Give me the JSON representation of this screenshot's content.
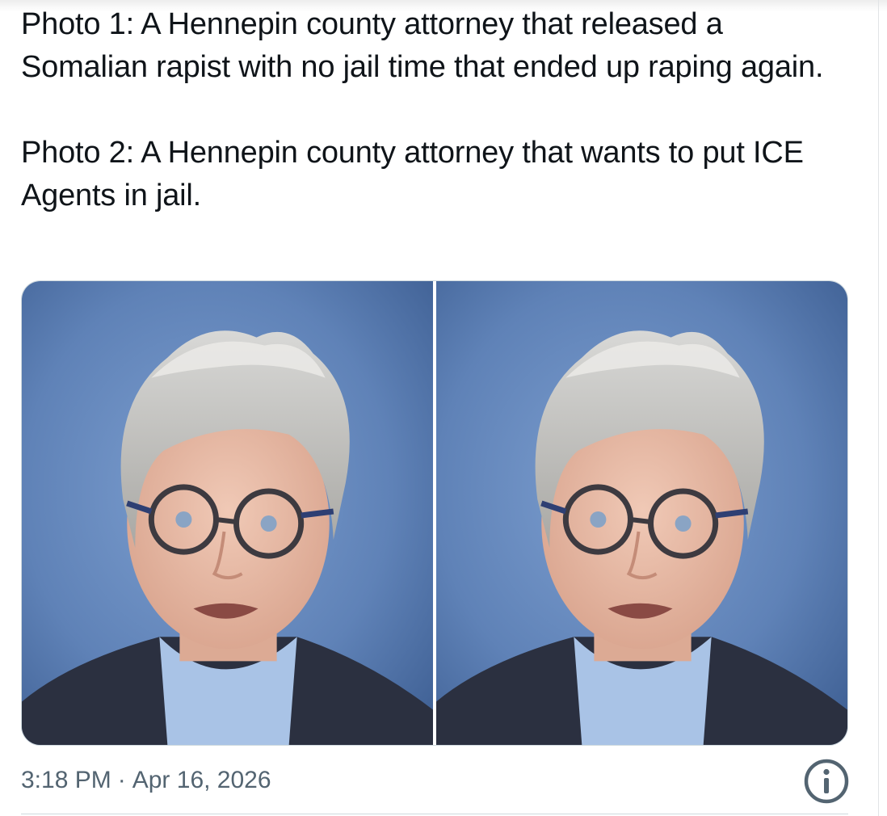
{
  "tweet": {
    "text_paragraphs": [
      "Photo 1: A Hennepin county attorney that released a Somalian rapist with no jail time that ended up raping again.",
      "Photo 2: A Hennepin county attorney that wants to put ICE Agents in jail."
    ],
    "media": [
      {
        "icon": "portrait-photo"
      },
      {
        "icon": "portrait-photo"
      }
    ],
    "time": "3:18 PM",
    "separator": "·",
    "date": "Apr 16, 2026",
    "info_icon": "info-circle-icon"
  },
  "colors": {
    "text_primary": "#0f1419",
    "text_secondary": "#536471",
    "border": "#cfd9de",
    "photo_background": "#5f82b7",
    "info_icon": "#536471"
  }
}
